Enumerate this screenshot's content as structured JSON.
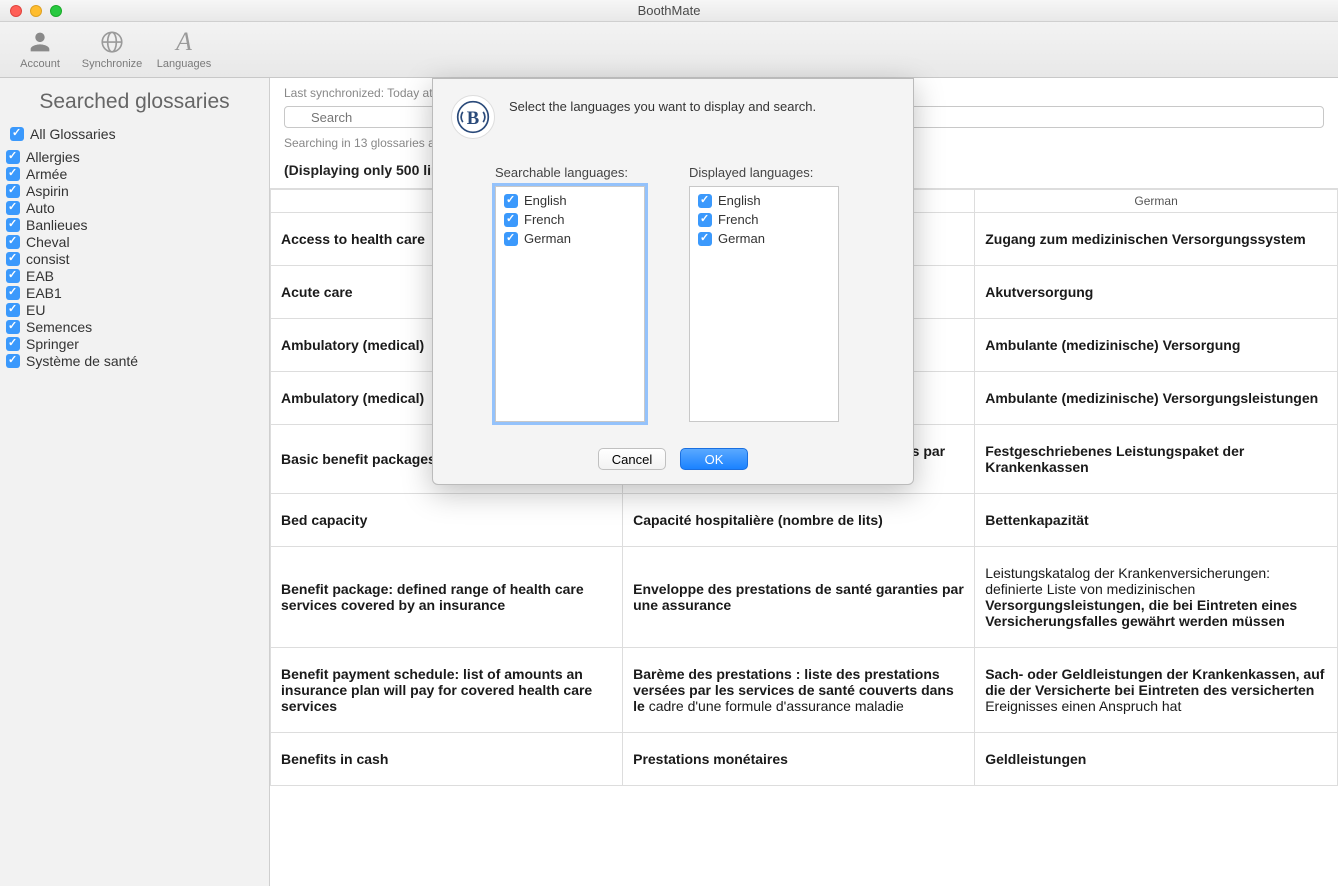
{
  "window": {
    "title": "BoothMate"
  },
  "toolbar": {
    "account": "Account",
    "synchronize": "Synchronize",
    "languages": "Languages"
  },
  "sidebar": {
    "title": "Searched glossaries",
    "all_label": "All Glossaries",
    "items": [
      {
        "label": "Allergies"
      },
      {
        "label": "Armée"
      },
      {
        "label": "Aspirin"
      },
      {
        "label": "Auto"
      },
      {
        "label": "Banlieues"
      },
      {
        "label": "Cheval"
      },
      {
        "label": "consist"
      },
      {
        "label": "EAB"
      },
      {
        "label": "EAB1"
      },
      {
        "label": "EU"
      },
      {
        "label": "Semences"
      },
      {
        "label": "Springer"
      },
      {
        "label": "Système de santé"
      }
    ]
  },
  "main": {
    "last_sync": "Last synchronized: Today at",
    "search_placeholder": "Search",
    "searching_in": "Searching in 13 glossaries a",
    "display_note": "(Displaying only 500 line"
  },
  "table": {
    "headers": {
      "german": "German"
    },
    "rows": [
      {
        "en": "Access to health care",
        "fr": "",
        "de": "Zugang zum medizinischen Versorgungssystem"
      },
      {
        "en": "Acute care",
        "fr": "",
        "de": "Akutversorgung"
      },
      {
        "en": "Ambulatory (medical)",
        "fr": "",
        "de": "Ambulante (medizinische) Versorgung"
      },
      {
        "en": "Ambulatory (medical)",
        "fr": "",
        "de": "Ambulante (medizinische) Versorgungsleistungen"
      },
      {
        "en": "Basic benefit packages of the sickness funds",
        "fr": "Enveloppe de base des prestations servies par les caisses maladies",
        "de": "Festgeschriebenes Leistungspaket der Krankenkassen"
      },
      {
        "en": "Bed capacity",
        "fr": "Capacité hospitalière (nombre de lits)",
        "de": "Bettenkapazität"
      },
      {
        "en": "Benefit package: defined range of health care services covered by an insurance",
        "fr": "Enveloppe des prestations de santé garanties par une assurance",
        "de_html": "<span class=\"mixed-light\">Leistungskatalog der Krankenversicherungen: definierte Liste von medizinischen </span>Versorgungsleistungen, die bei Eintreten eines Versicherungsfalles gewährt werden müssen"
      },
      {
        "en": "Benefit payment schedule: list of amounts an insurance plan will pay for covered health care services",
        "fr": "Barème des prestations : liste des prestations versées par les services de santé couverts dans le <span class=\"mixed-light\">cadre d'une formule d'assurance maladie</span>",
        "de_html": "Sach- oder Geldleistungen der Krankenkassen, auf die der Versicherte bei Eintreten des versicherten <span class=\"mixed-light\">Ereignisses einen Anspruch hat</span>"
      },
      {
        "en": "Benefits in cash",
        "fr": "Prestations monétaires",
        "de": "Geldleistungen"
      }
    ]
  },
  "modal": {
    "title": "Select the languages you want to display and search.",
    "searchable_title": "Searchable languages:",
    "displayed_title": "Displayed languages:",
    "searchable": [
      {
        "label": "English"
      },
      {
        "label": "French"
      },
      {
        "label": "German"
      }
    ],
    "displayed": [
      {
        "label": "English"
      },
      {
        "label": "French"
      },
      {
        "label": "German"
      }
    ],
    "cancel": "Cancel",
    "ok": "OK"
  }
}
